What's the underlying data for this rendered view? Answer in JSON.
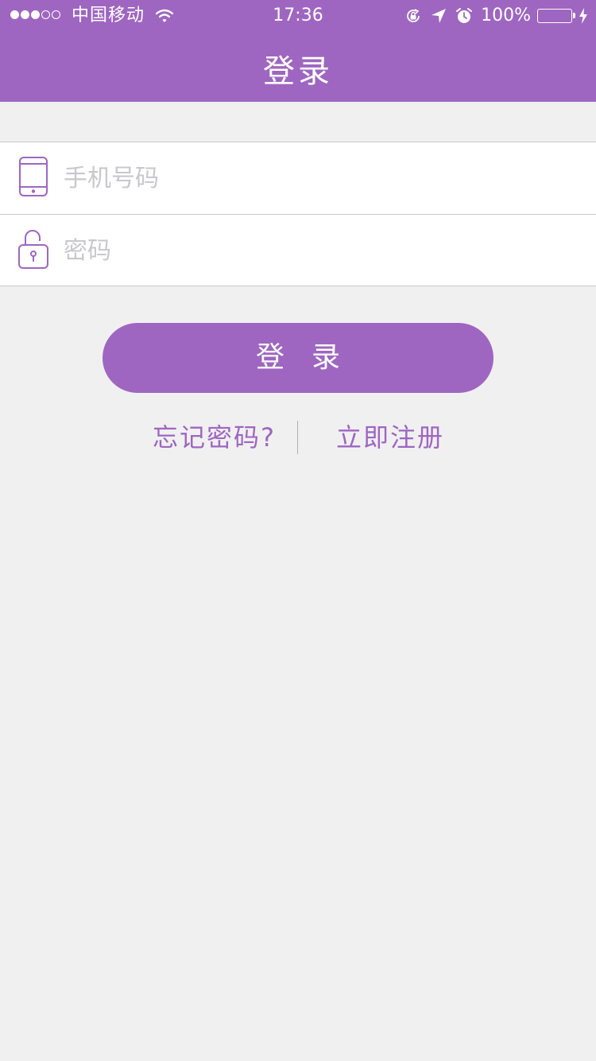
{
  "status_bar": {
    "carrier": "中国移动",
    "time": "17:36",
    "battery": "100%",
    "signal_bars_filled": 3,
    "signal_bars_total": 5,
    "icons": [
      "wifi-icon",
      "rotation-lock-icon",
      "location-arrow-icon",
      "alarm-icon",
      "battery-icon",
      "charging-icon"
    ]
  },
  "nav": {
    "title": "登录"
  },
  "form": {
    "phone": {
      "placeholder": "手机号码",
      "value": "",
      "icon": "phone-icon"
    },
    "password": {
      "placeholder": "密码",
      "value": "",
      "icon": "lock-icon"
    }
  },
  "login_button": {
    "label": "登录"
  },
  "links": {
    "forgot_password": "忘记密码?",
    "register": "立即注册"
  },
  "colors": {
    "accent": "#9e66c1",
    "background": "#f0f0f1",
    "placeholder": "#c8c8cc",
    "divider": "#c9c9cc"
  }
}
